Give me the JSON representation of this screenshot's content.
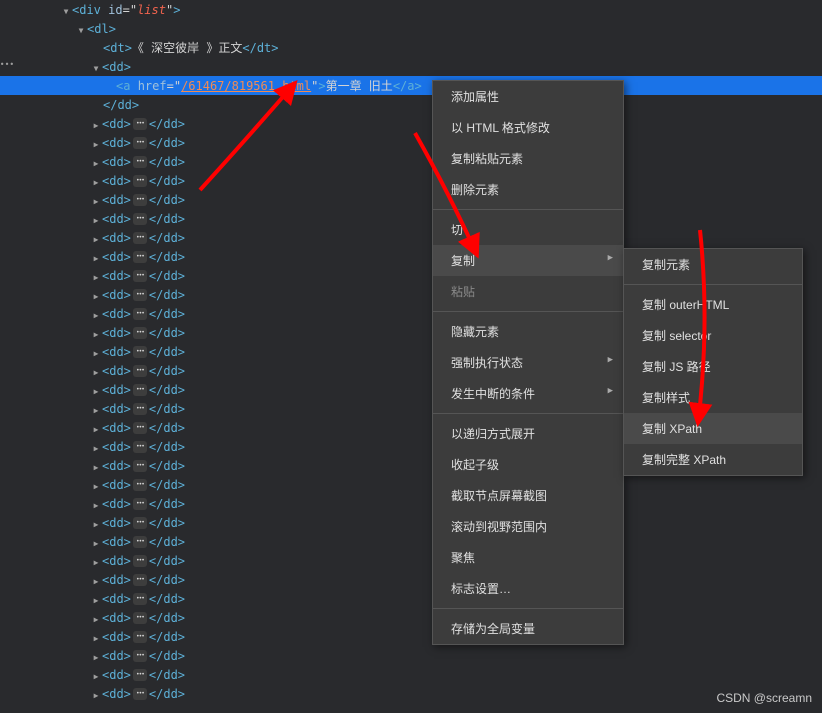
{
  "tree": {
    "div_open": {
      "tag": "div",
      "id_attr": "id",
      "id_val": "list"
    },
    "dl_tag": "dl",
    "dt": {
      "tag": "dt",
      "text": "《 深空彼岸 》正文"
    },
    "dd_tag": "dd",
    "a_link": {
      "tag": "a",
      "href_attr": "href",
      "href_val": "/61467/819561.html",
      "text": "第一章 旧土"
    }
  },
  "menu1": {
    "items": [
      {
        "label": "添加属性",
        "type": "item"
      },
      {
        "label": "以 HTML 格式修改",
        "type": "item"
      },
      {
        "label": "复制粘贴元素",
        "type": "item"
      },
      {
        "label": "删除元素",
        "type": "item"
      },
      {
        "type": "separator"
      },
      {
        "label": "切",
        "type": "item"
      },
      {
        "label": "复制",
        "type": "item",
        "submenu": true,
        "highlighted": true
      },
      {
        "label": "粘贴",
        "type": "item",
        "disabled": true
      },
      {
        "type": "separator"
      },
      {
        "label": "隐藏元素",
        "type": "item"
      },
      {
        "label": "强制执行状态",
        "type": "item",
        "submenu": true
      },
      {
        "label": "发生中断的条件",
        "type": "item",
        "submenu": true
      },
      {
        "type": "separator"
      },
      {
        "label": "以递归方式展开",
        "type": "item"
      },
      {
        "label": "收起子级",
        "type": "item"
      },
      {
        "label": "截取节点屏幕截图",
        "type": "item"
      },
      {
        "label": "滚动到视野范围内",
        "type": "item"
      },
      {
        "label": "聚焦",
        "type": "item"
      },
      {
        "label": "标志设置…",
        "type": "item"
      },
      {
        "type": "separator"
      },
      {
        "label": "存储为全局变量",
        "type": "item"
      }
    ]
  },
  "menu2": {
    "items": [
      {
        "label": "复制元素",
        "type": "item"
      },
      {
        "type": "separator"
      },
      {
        "label": "复制 outerHTML",
        "type": "item"
      },
      {
        "label": "复制 selector",
        "type": "item"
      },
      {
        "label": "复制 JS 路径",
        "type": "item"
      },
      {
        "label": "复制样式",
        "type": "item"
      },
      {
        "label": "复制 XPath",
        "type": "item",
        "highlighted": true
      },
      {
        "label": "复制完整 XPath",
        "type": "item"
      }
    ]
  },
  "watermark": "CSDN @screamn"
}
